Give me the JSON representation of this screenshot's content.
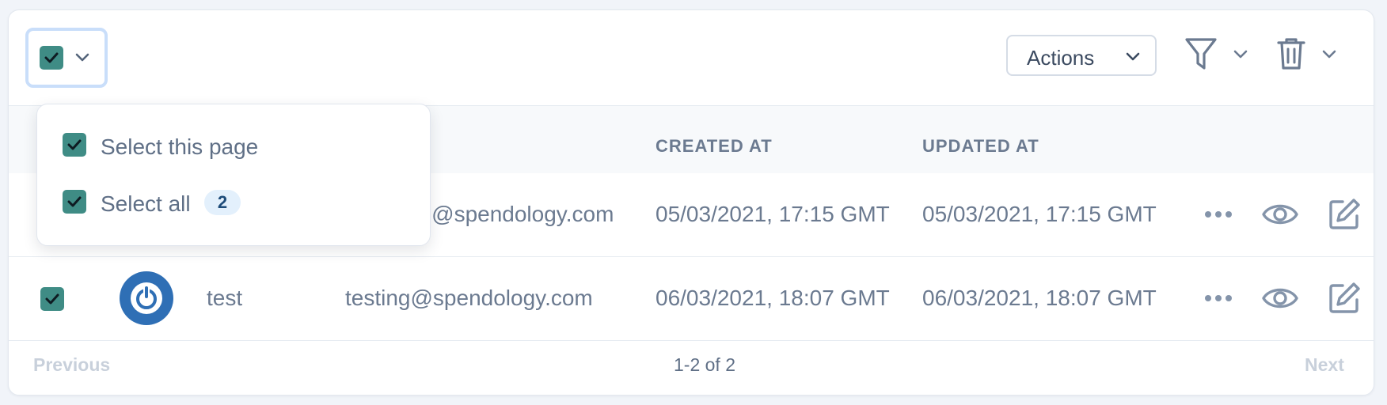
{
  "toolbar": {
    "actions_label": "Actions"
  },
  "bulk_select_menu": {
    "select_page_label": "Select this page",
    "select_all_label": "Select all",
    "select_all_count": "2"
  },
  "table": {
    "columns": [
      "CREATED AT",
      "UPDATED AT"
    ],
    "rows": [
      {
        "name": "",
        "email": "on@spendology.com",
        "created_at": "05/03/2021, 17:15 GMT",
        "updated_at": "05/03/2021, 17:15 GMT"
      },
      {
        "name": "test",
        "email": "testing@spendology.com",
        "created_at": "06/03/2021, 18:07 GMT",
        "updated_at": "06/03/2021, 18:07 GMT"
      }
    ]
  },
  "pagination": {
    "previous_label": "Previous",
    "range_label": "1-2 of 2",
    "next_label": "Next"
  },
  "icons": {
    "chevron": "chevron-down-icon",
    "filter": "filter-icon",
    "delete": "trash-icon",
    "more": "more-horizontal-icon",
    "view": "eye-icon",
    "edit": "edit-icon"
  },
  "colors": {
    "checkbox": "#3f8c85",
    "avatar": "#2f6fb5",
    "focus_ring": "#c9defa",
    "badge_bg": "#e3f0fc"
  }
}
